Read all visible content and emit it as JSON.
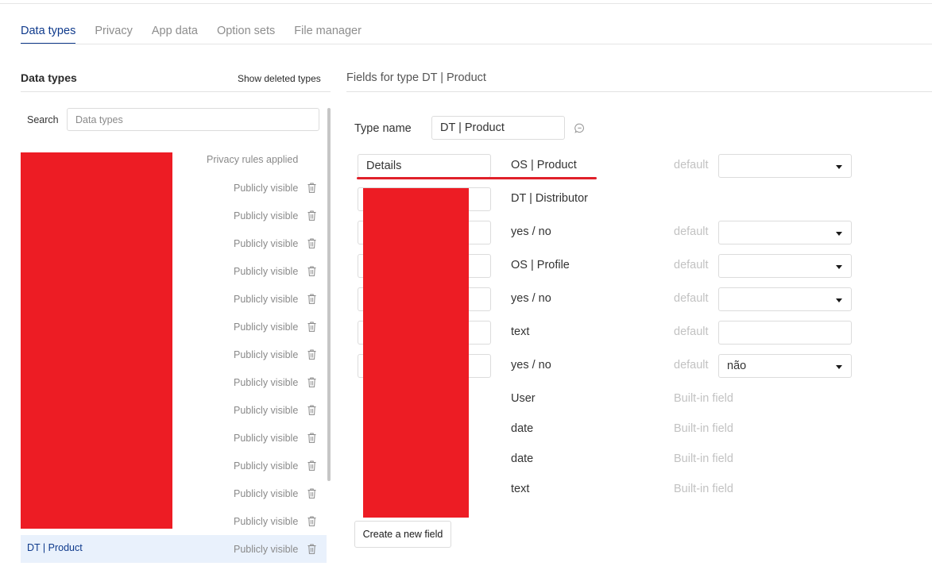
{
  "tabs": [
    {
      "label": "Data types",
      "active": true
    },
    {
      "label": "Privacy",
      "active": false
    },
    {
      "label": "App data",
      "active": false
    },
    {
      "label": "Option sets",
      "active": false
    },
    {
      "label": "File manager",
      "active": false
    }
  ],
  "left_panel": {
    "title": "Data types",
    "show_deleted_label": "Show deleted types",
    "search_label": "Search",
    "search_placeholder": "Data types",
    "privacy_header": "Privacy rules applied",
    "rows": [
      {
        "name": "",
        "privacy": "Publicly visible"
      },
      {
        "name": "",
        "privacy": "Publicly visible"
      },
      {
        "name": "",
        "privacy": "Publicly visible"
      },
      {
        "name": "",
        "privacy": "Publicly visible"
      },
      {
        "name": "",
        "privacy": "Publicly visible"
      },
      {
        "name": "",
        "privacy": "Publicly visible"
      },
      {
        "name": "",
        "privacy": "Publicly visible"
      },
      {
        "name": "",
        "privacy": "Publicly visible"
      },
      {
        "name": "",
        "privacy": "Publicly visible"
      },
      {
        "name": "",
        "privacy": "Publicly visible"
      },
      {
        "name": "",
        "privacy": "Publicly visible"
      },
      {
        "name": "",
        "privacy": "Publicly visible"
      },
      {
        "name": "",
        "privacy": "Publicly visible"
      },
      {
        "name": "DT | Product",
        "privacy": "Publicly visible",
        "selected": true
      }
    ]
  },
  "right_panel": {
    "title": "Fields for type DT | Product",
    "type_name_label": "Type name",
    "type_name_value": "DT | Product",
    "default_label": "default",
    "builtin_label": "Built-in field",
    "fields": [
      {
        "name": "Details",
        "type": "OS | Product",
        "kind": "dropdown",
        "default": ""
      },
      {
        "name": "",
        "type": "DT | Distributor",
        "kind": "none"
      },
      {
        "name": "",
        "type": "yes / no",
        "kind": "dropdown",
        "default": ""
      },
      {
        "name": "",
        "type": "OS | Profile",
        "kind": "dropdown",
        "default": ""
      },
      {
        "name": "",
        "type": "yes / no",
        "kind": "dropdown",
        "default": ""
      },
      {
        "name": "",
        "type": "text",
        "kind": "text",
        "default": ""
      },
      {
        "name": "",
        "type": "yes / no",
        "kind": "dropdown",
        "default": "não"
      },
      {
        "name": "",
        "type": "User",
        "kind": "builtin"
      },
      {
        "name": "",
        "type": "date",
        "kind": "builtin"
      },
      {
        "name": "",
        "type": "date",
        "kind": "builtin"
      },
      {
        "name": "",
        "type": "text",
        "kind": "builtin"
      }
    ],
    "create_field_label": "Create a new field"
  },
  "colors": {
    "accent": "#0f3a8c",
    "muted_text": "#8a8a8a",
    "selected_row_bg": "#e9f1fc",
    "redaction": "#ed1c24",
    "annotation_underline": "#e0202a"
  },
  "icons": {
    "row_action": "trash-icon",
    "type_name_action": "comment-icon",
    "dropdown": "chevron-down-icon"
  }
}
